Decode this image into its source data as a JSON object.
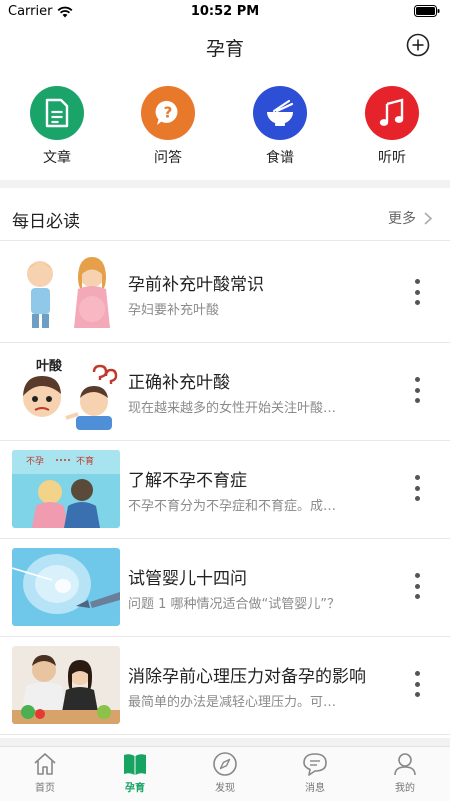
{
  "status_bar": {
    "carrier": "Carrier",
    "time": "10:52 PM"
  },
  "nav": {
    "title": "孕育",
    "add_icon": "plus-circle-icon"
  },
  "quick_menu": [
    {
      "label": "文章",
      "icon": "document-icon",
      "color": "#1aa46a"
    },
    {
      "label": "问答",
      "icon": "question-bubble-icon",
      "color": "#e8792a"
    },
    {
      "label": "食谱",
      "icon": "bowl-icon",
      "color": "#2d4fd6"
    },
    {
      "label": "听听",
      "icon": "music-note-icon",
      "color": "#e6232b"
    }
  ],
  "section": {
    "title": "每日必读",
    "more": "更多"
  },
  "articles": [
    {
      "title": "孕前补充叶酸常识",
      "desc": "孕妇要补充叶酸"
    },
    {
      "title": "正确补充叶酸",
      "desc": "现在越来越多的女性开始关注叶酸…",
      "thumb_text": "叶酸"
    },
    {
      "title": "了解不孕不育症",
      "desc": "不孕不育分为不孕症和不育症。成…",
      "thumb_text_a": "不孕",
      "thumb_text_b": "不育"
    },
    {
      "title": "试管婴儿十四问",
      "desc": "问题 1   哪种情况适合做“试管婴儿”？"
    },
    {
      "title": "消除孕前心理压力对备孕的影响",
      "desc": "最简单的办法是减轻心理压力。可…"
    }
  ],
  "tabs": [
    {
      "label": "首页",
      "icon": "home-icon",
      "active": false
    },
    {
      "label": "孕育",
      "icon": "book-icon",
      "active": true
    },
    {
      "label": "发现",
      "icon": "compass-icon",
      "active": false
    },
    {
      "label": "消息",
      "icon": "chat-bubble-icon",
      "active": false
    },
    {
      "label": "我的",
      "icon": "person-icon",
      "active": false
    }
  ],
  "colors": {
    "accent": "#17a361",
    "divider": "#e8e8e8",
    "muted_text": "#8a8a8a"
  }
}
